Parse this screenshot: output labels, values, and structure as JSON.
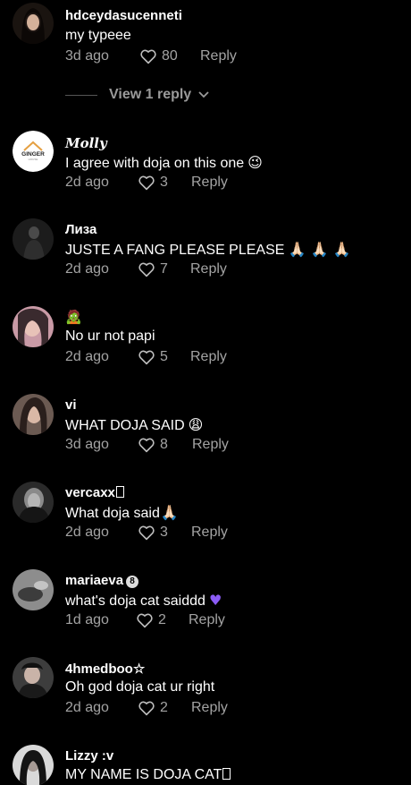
{
  "comments": [
    {
      "username": "hdceydasucenneti",
      "text": "my typeee",
      "date": "3d ago",
      "likes": "80",
      "reply": "Reply"
    },
    {
      "username": "𝑴𝒐𝒍𝒍𝒚",
      "text": "I agree with doja on this one",
      "date": "2d ago",
      "likes": "3",
      "reply": "Reply",
      "avatar_text": "GINGER"
    },
    {
      "username": "Лиза",
      "text": "JUSTE A FANG PLEASE PLEASE",
      "date": "2d ago",
      "likes": "7",
      "reply": "Reply"
    },
    {
      "username": "🧟",
      "text": "No ur not papi",
      "date": "2d ago",
      "likes": "5",
      "reply": "Reply"
    },
    {
      "username": "vi",
      "text": "WHAT DOJA SAID",
      "date": "3d ago",
      "likes": "8",
      "reply": "Reply"
    },
    {
      "username": "vercaxx",
      "text": "What doja said",
      "date": "2d ago",
      "likes": "3",
      "reply": "Reply"
    },
    {
      "username": "mariaeva",
      "text": "what's doja cat saiddd",
      "date": "1d ago",
      "likes": "2",
      "reply": "Reply",
      "badge": "8"
    },
    {
      "username": "4hmedboo☆",
      "text": "Oh god doja cat ur right",
      "date": "2d ago",
      "likes": "2",
      "reply": "Reply"
    },
    {
      "username": "Lizzy :v",
      "text": "MY NAME IS DOJA CAT",
      "date": "",
      "likes": "",
      "reply": ""
    }
  ],
  "view_replies": {
    "label": "View 1 reply"
  },
  "icons": {
    "like": "heart-outline-icon",
    "chevron": "chevron-down-icon"
  },
  "colors": {
    "background": "#000000",
    "meta": "#a3a3a3",
    "accent_heart": "#8b5cf6"
  }
}
